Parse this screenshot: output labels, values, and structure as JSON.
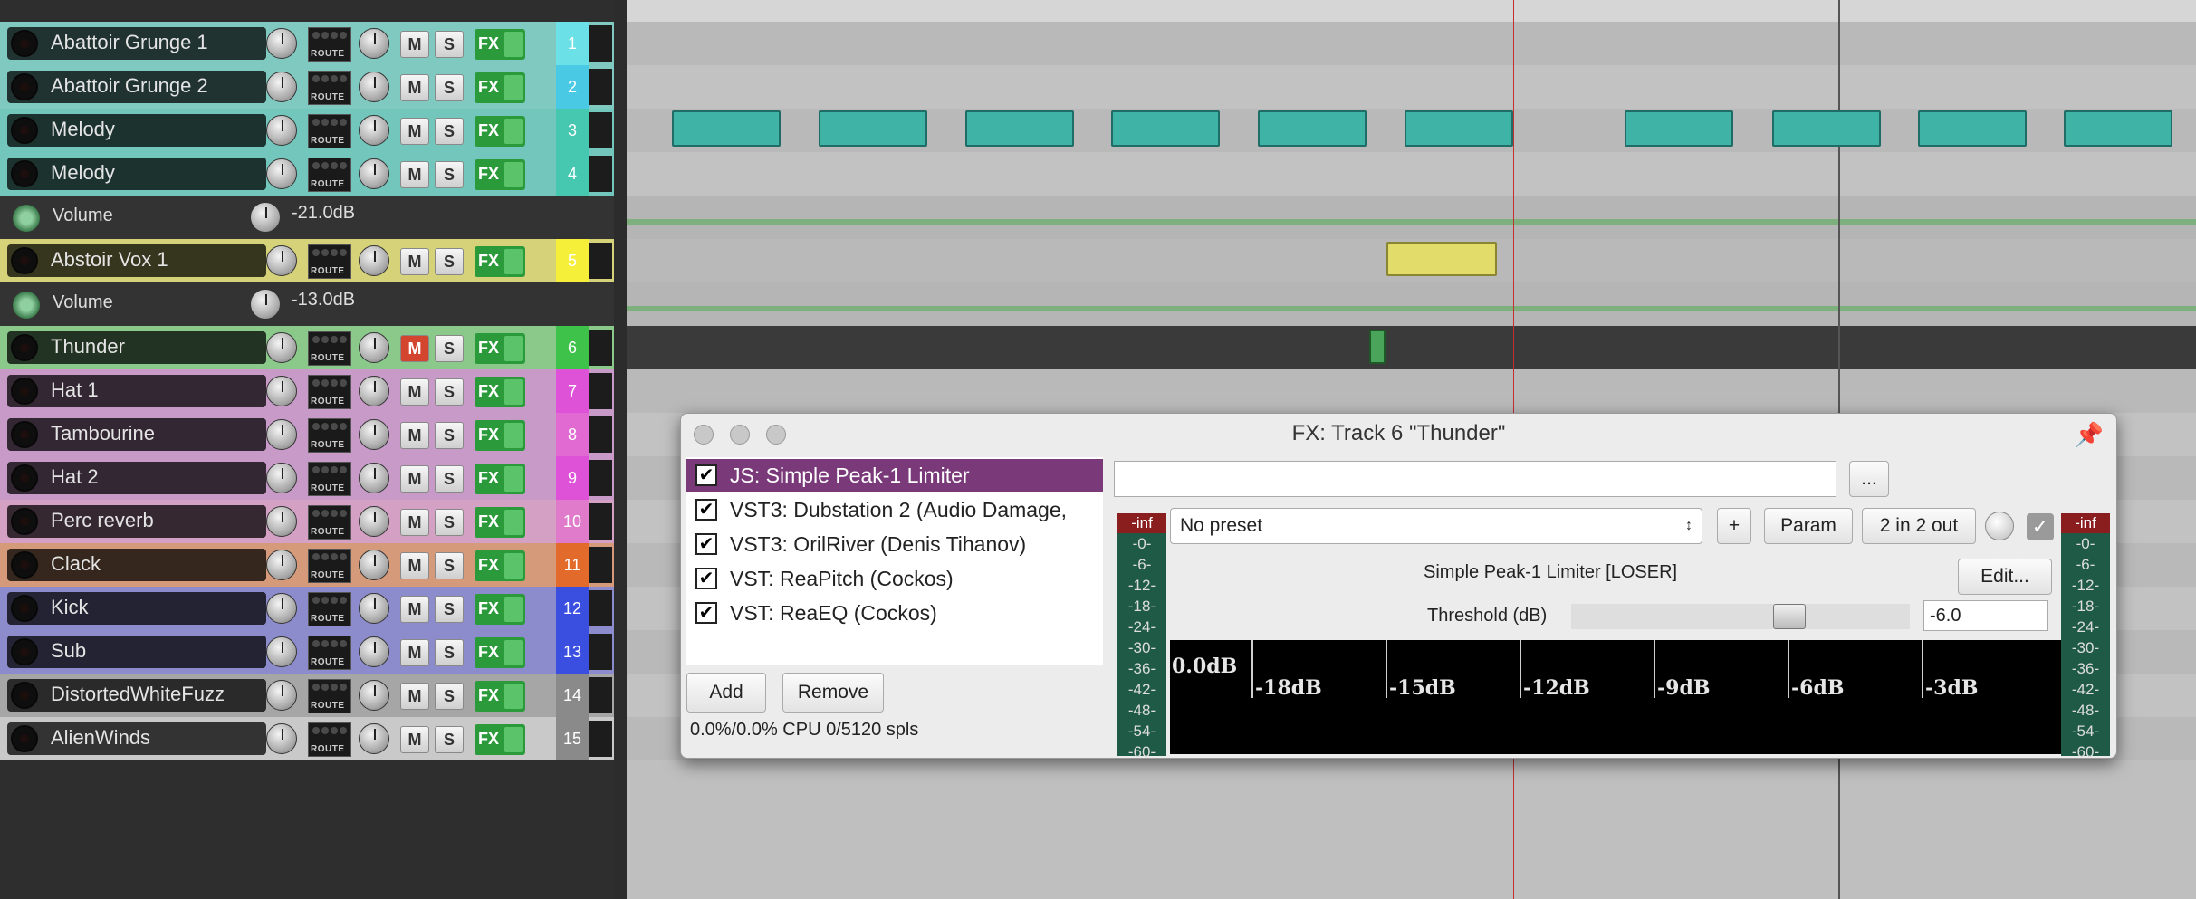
{
  "tracks": [
    {
      "number": "1",
      "name": "Abattoir Grunge 1",
      "color": "#7fc9c1",
      "num_color": "#6be0e6",
      "muted": false
    },
    {
      "number": "2",
      "name": "Abattoir Grunge 2",
      "color": "#7fc9c1",
      "num_color": "#49c9e3",
      "muted": false
    },
    {
      "number": "3",
      "name": "Melody",
      "color": "#72c6bb",
      "num_color": "#46c7b0",
      "muted": false
    },
    {
      "number": "4",
      "name": "Melody",
      "color": "#72c6bb",
      "num_color": "#46c7b0",
      "muted": false
    },
    {
      "number": "5",
      "name": "Abstoir Vox 1",
      "color": "#d6d27a",
      "num_color": "#f5ef3a",
      "muted": false
    },
    {
      "number": "6",
      "name": "Thunder",
      "color": "#8ac98a",
      "num_color": "#3ec24a",
      "muted": true
    },
    {
      "number": "7",
      "name": "Hat 1",
      "color": "#c79ac7",
      "num_color": "#de52d8",
      "muted": false
    },
    {
      "number": "8",
      "name": "Tambourine",
      "color": "#c79ac7",
      "num_color": "#e06ad2",
      "muted": false
    },
    {
      "number": "9",
      "name": "Hat 2",
      "color": "#c79ac7",
      "num_color": "#de52d8",
      "muted": false
    },
    {
      "number": "10",
      "name": "Perc reverb",
      "color": "#d4a0c4",
      "num_color": "#e07acb",
      "muted": false
    },
    {
      "number": "11",
      "name": "Clack",
      "color": "#d49a7a",
      "num_color": "#e26a2a",
      "muted": false
    },
    {
      "number": "12",
      "name": "Kick",
      "color": "#8c8ccc",
      "num_color": "#3a4ee0",
      "muted": false
    },
    {
      "number": "13",
      "name": "Sub",
      "color": "#8c8ccc",
      "num_color": "#3a4ee0",
      "muted": false
    },
    {
      "number": "14",
      "name": "DistortedWhiteFuzz",
      "color": "#a6a6a6",
      "num_color": "#8a8a8a",
      "muted": false
    },
    {
      "number": "15",
      "name": "AlienWinds",
      "color": "#c9c9c9",
      "num_color": "#8a8a8a",
      "muted": false
    }
  ],
  "labels": {
    "route": "ROUTE",
    "mute": "M",
    "solo": "S",
    "fx": "FX"
  },
  "envelopes": [
    {
      "name": "Volume",
      "value": "-21.0dB"
    },
    {
      "name": "Volume",
      "value": "-13.0dB"
    }
  ],
  "fx_window": {
    "title": "FX: Track 6 \"Thunder\"",
    "plugins": [
      {
        "name": "JS: Simple Peak-1 Limiter",
        "enabled": true,
        "selected": true
      },
      {
        "name": "VST3: Dubstation 2 (Audio Damage,",
        "enabled": true,
        "selected": false
      },
      {
        "name": "VST3: OrilRiver (Denis Tihanov)",
        "enabled": true,
        "selected": false
      },
      {
        "name": "VST: ReaPitch (Cockos)",
        "enabled": true,
        "selected": false
      },
      {
        "name": "VST: ReaEQ (Cockos)",
        "enabled": true,
        "selected": false
      }
    ],
    "add_label": "Add",
    "remove_label": "Remove",
    "cpu_text": "0.0%/0.0% CPU 0/5120 spls",
    "more_label": "...",
    "preset": "No preset",
    "plus_label": "+",
    "param_label": "Param",
    "io_label": "2 in 2 out",
    "plugin_title": "Simple Peak-1 Limiter [LOSER]",
    "edit_label": "Edit...",
    "threshold_label": "Threshold (dB)",
    "threshold_value": "-6.0",
    "threshold_fraction": 0.66,
    "meter_top": "-inf",
    "meter_labels": [
      "-0-",
      "-6-",
      "-12-",
      "-18-",
      "-24-",
      "-30-",
      "-36-",
      "-42-",
      "-48-",
      "-54-",
      "-60-"
    ],
    "graph_labels": [
      "0.0dB",
      "-18dB",
      "-15dB",
      "-12dB",
      "-9dB",
      "-6dB",
      "-3dB"
    ]
  }
}
